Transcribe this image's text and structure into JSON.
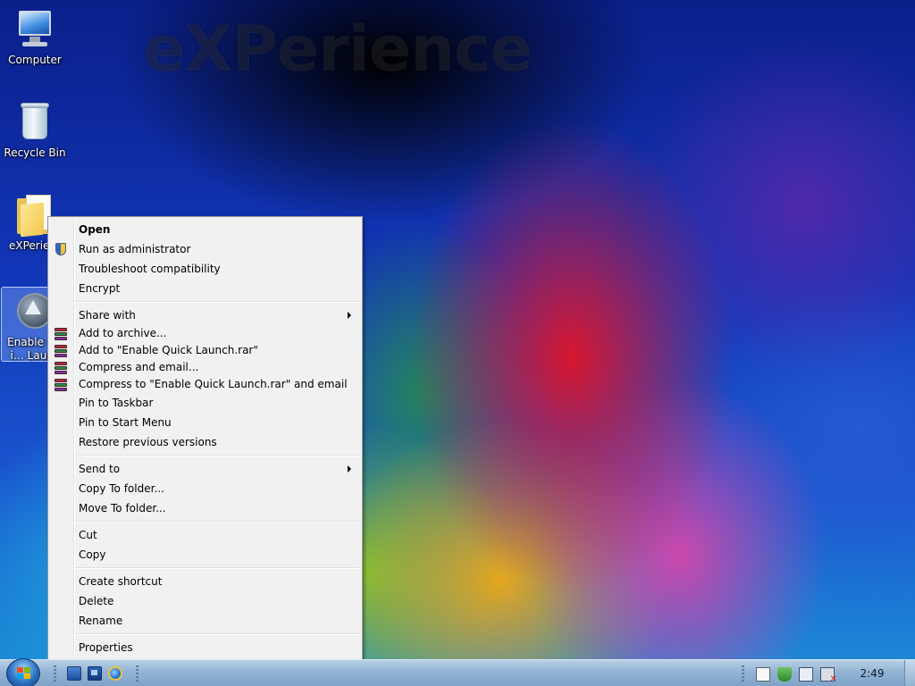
{
  "desktop": {
    "watermark": "eXPerience",
    "icons": [
      {
        "label": "Computer",
        "icon": "computer-icon"
      },
      {
        "label": "Recycle Bin",
        "icon": "recycle-bin-icon"
      },
      {
        "label": "eXPerien",
        "icon": "folder-icon"
      },
      {
        "label": "Enable Qui… Launch.…",
        "icon": "aimp-icon"
      }
    ]
  },
  "context_menu": {
    "items": [
      {
        "label": "Open",
        "bold": true
      },
      {
        "label": "Run as administrator",
        "icon": "uac-shield-icon"
      },
      {
        "label": "Troubleshoot compatibility"
      },
      {
        "label": "Encrypt"
      },
      {
        "label": "Share with",
        "submenu": true
      },
      {
        "label": "Add to archive...",
        "icon": "winrar-icon"
      },
      {
        "label": "Add to \"Enable Quick Launch.rar\"",
        "icon": "winrar-icon"
      },
      {
        "label": "Compress and email...",
        "icon": "winrar-icon"
      },
      {
        "label": "Compress to \"Enable Quick Launch.rar\" and email",
        "icon": "winrar-icon"
      },
      {
        "label": "Pin to Taskbar"
      },
      {
        "label": "Pin to Start Menu"
      },
      {
        "label": "Restore previous versions"
      },
      {
        "label": "Send to",
        "submenu": true
      },
      {
        "label": "Copy To folder..."
      },
      {
        "label": "Move To folder..."
      },
      {
        "label": "Cut"
      },
      {
        "label": "Copy"
      },
      {
        "label": "Create shortcut"
      },
      {
        "label": "Delete"
      },
      {
        "label": "Rename"
      },
      {
        "label": "Properties"
      }
    ]
  },
  "taskbar": {
    "start_button": "start-orb-icon",
    "quick_launch": [
      "show-desktop-icon",
      "switch-windows-icon",
      "internet-explorer-icon"
    ],
    "tray_icons": [
      "action-center-flag-icon",
      "security-shield-icon",
      "network-icon",
      "volume-muted-icon"
    ],
    "clock": "2:49"
  },
  "colors": {
    "menu_background": "#f1f1f1",
    "menu_border": "#979797",
    "taskbar": "#93b4d4"
  }
}
